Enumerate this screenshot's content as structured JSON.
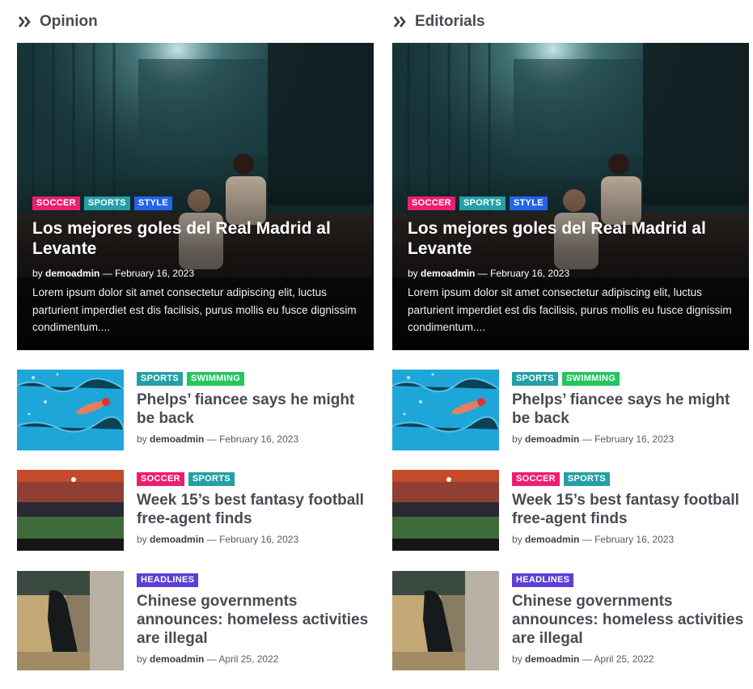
{
  "sections": [
    {
      "title": "Opinion",
      "hero": {
        "tags": [
          "SOCCER",
          "SPORTS",
          "STYLE"
        ],
        "title": "Los mejores goles del Real Madrid al Levante",
        "by": "by",
        "author": "demoadmin",
        "dash": "—",
        "date": "February 16, 2023",
        "excerpt": "Lorem ipsum dolor sit amet consectetur adipiscing elit, luctus parturient imperdiet est dis facilisis, purus mollis eu fusce dignissim condimentum...."
      },
      "items": [
        {
          "tags": [
            "SPORTS",
            "SWIMMING"
          ],
          "title": "Phelps’ fiancee says he might be back",
          "by": "by",
          "author": "demoadmin",
          "dash": "—",
          "date": "February 16, 2023"
        },
        {
          "tags": [
            "SOCCER",
            "SPORTS"
          ],
          "title": "Week 15’s best fantasy football free-agent finds",
          "by": "by",
          "author": "demoadmin",
          "dash": "—",
          "date": "February 16, 2023"
        },
        {
          "tags": [
            "HEADLINES"
          ],
          "title": "Chinese governments announces: homeless activities are illegal",
          "by": "by",
          "author": "demoadmin",
          "dash": "—",
          "date": "April 25, 2022"
        }
      ]
    },
    {
      "title": "Editorials",
      "hero": {
        "tags": [
          "SOCCER",
          "SPORTS",
          "STYLE"
        ],
        "title": "Los mejores goles del Real Madrid al Levante",
        "by": "by",
        "author": "demoadmin",
        "dash": "—",
        "date": "February 16, 2023",
        "excerpt": "Lorem ipsum dolor sit amet consectetur adipiscing elit, luctus parturient imperdiet est dis facilisis, purus mollis eu fusce dignissim condimentum...."
      },
      "items": [
        {
          "tags": [
            "SPORTS",
            "SWIMMING"
          ],
          "title": "Phelps’ fiancee says he might be back",
          "by": "by",
          "author": "demoadmin",
          "dash": "—",
          "date": "February 16, 2023"
        },
        {
          "tags": [
            "SOCCER",
            "SPORTS"
          ],
          "title": "Week 15’s best fantasy football free-agent finds",
          "by": "by",
          "author": "demoadmin",
          "dash": "—",
          "date": "February 16, 2023"
        },
        {
          "tags": [
            "HEADLINES"
          ],
          "title": "Chinese governments announces: homeless activities are illegal",
          "by": "by",
          "author": "demoadmin",
          "dash": "—",
          "date": "April 25, 2022"
        }
      ]
    }
  ],
  "colors": {
    "soccer": "#ee1d70",
    "sports": "#23a0a8",
    "style": "#2563eb",
    "swimming": "#22c55e",
    "headlines": "#5b3fd6"
  },
  "icons": {
    "section": "double-chevron-right-icon"
  }
}
